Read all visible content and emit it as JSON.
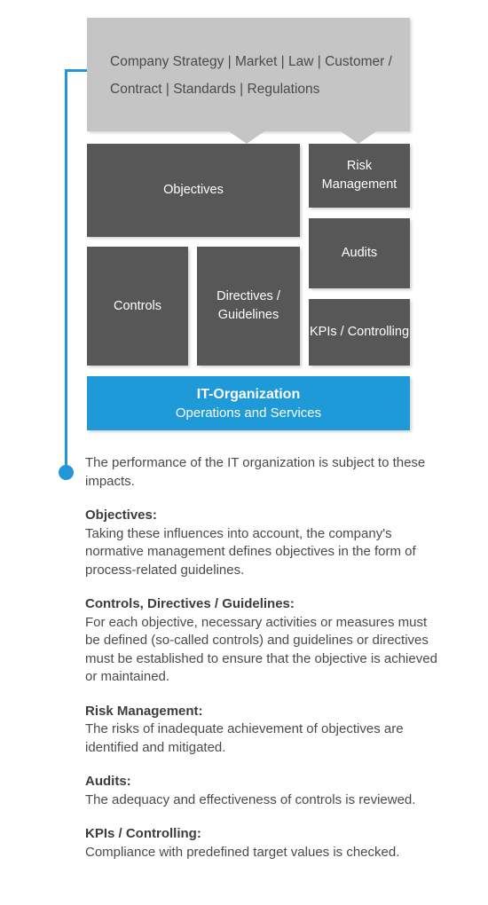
{
  "colors": {
    "dark_box": "#575757",
    "light_gray_callout": "#c5c5c5",
    "accent_blue": "#1e9ad9",
    "connector_blue": "#2196d8",
    "body_text": "#4a4a4a",
    "background": "#ffffff"
  },
  "callout": {
    "text": "Company Strategy | Market | Law | Customer / Contract | Standards | Regulations"
  },
  "diagram": {
    "boxes": [
      {
        "id": "objectives",
        "label": "Objectives"
      },
      {
        "id": "controls",
        "label": "Controls"
      },
      {
        "id": "directives",
        "label": "Directives / Guidelines"
      },
      {
        "id": "risk",
        "label": "Risk Management"
      },
      {
        "id": "audits",
        "label": "Audits"
      },
      {
        "id": "kpis",
        "label": "KPIs / Controlling"
      }
    ],
    "it_organization": {
      "title": "IT-Organization",
      "subtitle": "Operations and Services"
    }
  },
  "copy": {
    "intro": "The performance of the IT organization is subject to these impacts.",
    "sections": [
      {
        "heading": "Objectives",
        "heading_suffix": ":",
        "body": "Taking these influences into account, the company's normative management defines objectives in the form of process-related guidelines."
      },
      {
        "heading": "Controls, Directives / Guidelines",
        "heading_suffix": ":",
        "body": "For each objective, necessary activities or measures must be defined (so-called controls) and guidelines or directives must be established to ensure that the objective is achieved or maintained."
      },
      {
        "heading": "Risk Management",
        "heading_suffix": ":",
        "body": "The risks of inadequate achievement of objectives are identified and mitigated."
      },
      {
        "heading": "Audits",
        "heading_suffix": ":",
        "body": "The adequacy and effectiveness of controls is reviewed."
      },
      {
        "heading": "KPIs / Controlling",
        "heading_suffix": ":",
        "body": "Compliance with predefined target values is checked."
      }
    ]
  }
}
